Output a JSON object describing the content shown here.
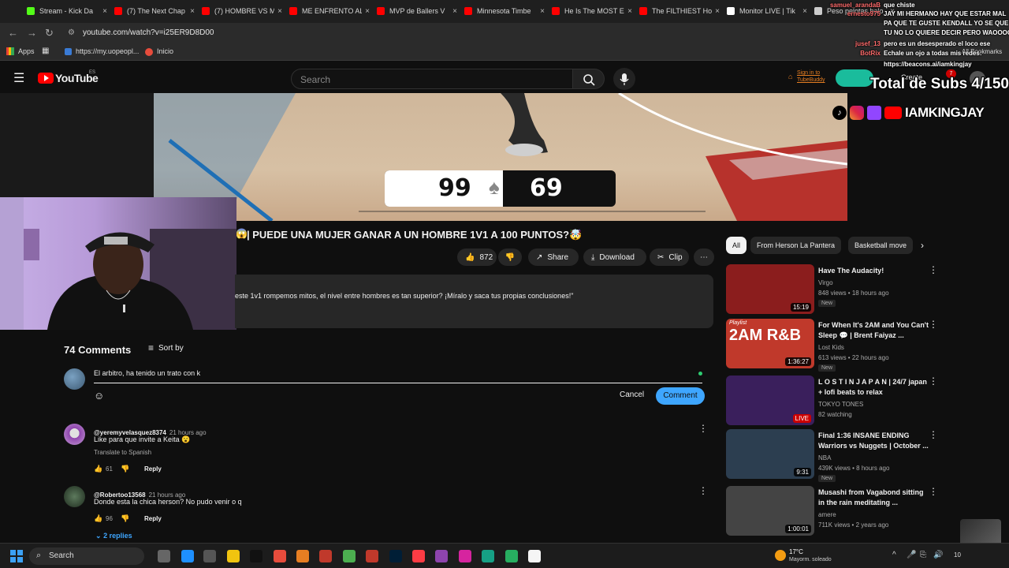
{
  "browser": {
    "tabs": [
      {
        "title": "Stream - Kick Da",
        "color": "#53fc18"
      },
      {
        "title": "(7) The Next Chap",
        "color": "#ff0000"
      },
      {
        "title": "(7) HOMBRE VS M",
        "color": "#ff0000"
      },
      {
        "title": "ME ENFRENTO AL",
        "color": "#ff0000"
      },
      {
        "title": "MVP de Ballers V",
        "color": "#ff0000"
      },
      {
        "title": "Minnesota Timbe",
        "color": "#ff0000"
      },
      {
        "title": "He Is The MOST E",
        "color": "#ff0000"
      },
      {
        "title": "The FILTHIEST Ho",
        "color": "#ff0000"
      },
      {
        "title": "Monitor LIVE | Tik",
        "color": "#ffffff"
      },
      {
        "title": "Peso pelotas balo",
        "color": "#cccccc"
      }
    ],
    "url": "youtube.com/watch?v=i25ER9D8D00",
    "bookmarks": [
      "Apps",
      "https://my.uopeopl...",
      "Inicio"
    ],
    "all_bookmarks": "All Bookmarks"
  },
  "youtube": {
    "logo_text": "YouTube",
    "region": "ES",
    "search_placeholder": "Search",
    "tubebuddy": "Sign in to TubeBuddy",
    "create": "Create",
    "notif_count": "7"
  },
  "video": {
    "score_left": "99",
    "score_right": "69",
    "title": "| PUEDE UNA MUJER GANAR A UN HOMBRE 1V1 A 100 PUNTOS?🤯",
    "likes": "872",
    "share": "Share",
    "download": "Download",
    "clip": "Clip",
    "description": "este 1v1 rompemos mitos, el nivel entre hombres es tan superior? ¡Míralo y saca tus propias conclusiones!\""
  },
  "comments": {
    "count_label": "74 Comments",
    "sort_label": "Sort by",
    "draft": "El arbitro, ha tenido un trato con k",
    "cancel": "Cancel",
    "submit": "Comment",
    "items": [
      {
        "author": "@yeremyvelasquez8374",
        "ago": "21 hours ago",
        "text": "Like para que invite a Keita 😮",
        "translate": "Translate to Spanish",
        "likes": "61",
        "reply": "Reply"
      },
      {
        "author": "@Robertoo13568",
        "ago": "21 hours ago",
        "text": "Donde esta la chica herson? No pudo venir o q",
        "likes": "96",
        "reply": "Reply",
        "replies": "2 replies"
      }
    ]
  },
  "sidebar": {
    "chips": [
      "All",
      "From Herson La Pantera",
      "Basketball move"
    ],
    "videos": [
      {
        "title": "Have The Audacity!",
        "channel": "Virgo",
        "meta": "848 views • 18 hours ago",
        "badge": "New",
        "duration": "15:19",
        "thumb": "#8b1d1d"
      },
      {
        "title": "For When It's 2AM and You Can't Sleep 💬 | Brent Faiyaz ...",
        "channel": "Lost Kids",
        "meta": "613 views • 22 hours ago",
        "badge": "New",
        "duration": "1:36:27",
        "thumb": "#c0392b",
        "overlay": "2AM R&B",
        "tag": "Playlist"
      },
      {
        "title": "L O S T  I N  J A P A N | 24/7 japan + lofi beats to relax",
        "channel": "TOKYO TONES",
        "meta": "82 watching",
        "badge": "",
        "duration": "LIVE",
        "thumb": "#3a1f5c"
      },
      {
        "title": "Final 1:36 INSANE ENDING Warriors vs Nuggets | October ...",
        "channel": "NBA",
        "meta": "439K views • 8 hours ago",
        "badge": "New",
        "duration": "9:31",
        "thumb": "#2c3e50"
      },
      {
        "title": "Musashi from Vagabond sitting in the rain meditating ...",
        "channel": "amere",
        "meta": "711K views • 2 years ago",
        "badge": "",
        "duration": "1:00:01",
        "thumb": "#444444"
      }
    ]
  },
  "stream_overlay": {
    "chat": [
      {
        "user": "samuel_arandaB",
        "msg": "que chiste"
      },
      {
        "user": "ernesto975",
        "msg": "JAY MI HERMANO HAY QUE ESTAR MAL"
      },
      {
        "user": "",
        "msg": "PA QUE TE GUSTE KENDALL YO SE QUE"
      },
      {
        "user": "",
        "msg": "TU NO LO QUIERE DECIR PERO WAOOOO"
      },
      {
        "user": "jusef_13",
        "msg": "pero es un desesperado el loco ese"
      },
      {
        "user": "BotRix",
        "msg": "Echale un ojo a todas mis redes:"
      },
      {
        "user": "",
        "msg": "https://beacons.ai/iamkingjay"
      }
    ],
    "subs_goal": "Total de Subs 4/150",
    "handle": "IAMKINGJAY"
  },
  "taskbar": {
    "search": "Search",
    "weather_temp": "17°C",
    "weather_desc": "Mayorm. soleado",
    "clock": "10"
  }
}
